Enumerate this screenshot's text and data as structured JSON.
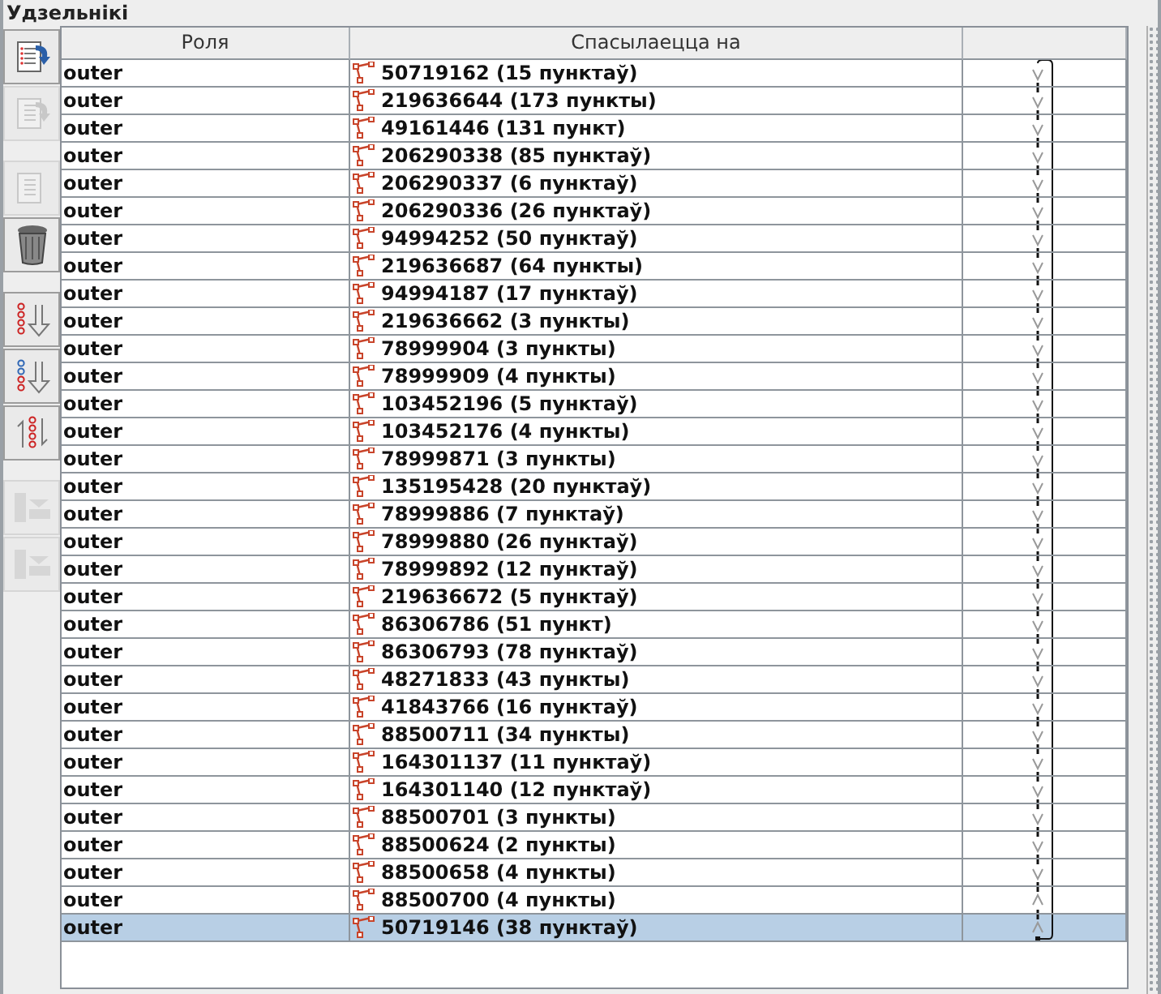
{
  "panel": {
    "title": "Удзельнікі"
  },
  "toolbar_groups": [
    [
      {
        "kind": "add-list",
        "disabled": false
      },
      {
        "kind": "doc-arrow",
        "disabled": true
      }
    ],
    [
      {
        "kind": "doc",
        "disabled": true
      },
      {
        "kind": "trash",
        "disabled": false
      }
    ],
    [
      {
        "kind": "sort",
        "disabled": false
      },
      {
        "kind": "sort-mixed",
        "disabled": false
      },
      {
        "kind": "reverse",
        "disabled": false
      }
    ],
    [
      {
        "kind": "move",
        "disabled": true
      },
      {
        "kind": "move",
        "disabled": true
      }
    ]
  ],
  "table": {
    "columns": [
      "Роля",
      "Спасылаецца на"
    ],
    "rows": [
      {
        "role": "outer",
        "ref": "50719162 (15 пунктаў)",
        "kind": "down",
        "selected": false
      },
      {
        "role": "outer",
        "ref": "219636644 (173 пункты)",
        "kind": "down",
        "selected": false
      },
      {
        "role": "outer",
        "ref": "49161446 (131 пункт)",
        "kind": "down",
        "selected": false
      },
      {
        "role": "outer",
        "ref": "206290338 (85 пунктаў)",
        "kind": "down",
        "selected": false
      },
      {
        "role": "outer",
        "ref": "206290337 (6 пунктаў)",
        "kind": "down",
        "selected": false
      },
      {
        "role": "outer",
        "ref": "206290336 (26 пунктаў)",
        "kind": "down",
        "selected": false
      },
      {
        "role": "outer",
        "ref": "94994252 (50 пунктаў)",
        "kind": "down",
        "selected": false
      },
      {
        "role": "outer",
        "ref": "219636687 (64 пункты)",
        "kind": "down",
        "selected": false
      },
      {
        "role": "outer",
        "ref": "94994187 (17 пунктаў)",
        "kind": "down",
        "selected": false
      },
      {
        "role": "outer",
        "ref": "219636662 (3 пункты)",
        "kind": "down",
        "selected": false
      },
      {
        "role": "outer",
        "ref": "78999904 (3 пункты)",
        "kind": "down",
        "selected": false
      },
      {
        "role": "outer",
        "ref": "78999909 (4 пункты)",
        "kind": "down",
        "selected": false
      },
      {
        "role": "outer",
        "ref": "103452196 (5 пунктаў)",
        "kind": "down",
        "selected": false
      },
      {
        "role": "outer",
        "ref": "103452176 (4 пункты)",
        "kind": "down",
        "selected": false
      },
      {
        "role": "outer",
        "ref": "78999871 (3 пункты)",
        "kind": "down",
        "selected": false
      },
      {
        "role": "outer",
        "ref": "135195428 (20 пунктаў)",
        "kind": "down",
        "selected": false
      },
      {
        "role": "outer",
        "ref": "78999886 (7 пунктаў)",
        "kind": "down",
        "selected": false
      },
      {
        "role": "outer",
        "ref": "78999880 (26 пунктаў)",
        "kind": "down",
        "selected": false
      },
      {
        "role": "outer",
        "ref": "78999892 (12 пунктаў)",
        "kind": "down",
        "selected": false
      },
      {
        "role": "outer",
        "ref": "219636672 (5 пунктаў)",
        "kind": "down",
        "selected": false
      },
      {
        "role": "outer",
        "ref": "86306786 (51 пункт)",
        "kind": "down",
        "selected": false
      },
      {
        "role": "outer",
        "ref": "86306793 (78 пунктаў)",
        "kind": "down",
        "selected": false
      },
      {
        "role": "outer",
        "ref": "48271833 (43 пункты)",
        "kind": "down",
        "selected": false
      },
      {
        "role": "outer",
        "ref": "41843766 (16 пунктаў)",
        "kind": "down",
        "selected": false
      },
      {
        "role": "outer",
        "ref": "88500711 (34 пункты)",
        "kind": "down",
        "selected": false
      },
      {
        "role": "outer",
        "ref": "164301137 (11 пунктаў)",
        "kind": "down",
        "selected": false
      },
      {
        "role": "outer",
        "ref": "164301140 (12 пунктаў)",
        "kind": "down",
        "selected": false
      },
      {
        "role": "outer",
        "ref": "88500701 (3 пункты)",
        "kind": "down",
        "selected": false
      },
      {
        "role": "outer",
        "ref": "88500624 (2 пункты)",
        "kind": "down",
        "selected": false
      },
      {
        "role": "outer",
        "ref": "88500658 (4 пункты)",
        "kind": "down",
        "selected": false
      },
      {
        "role": "outer",
        "ref": "88500700 (4 пункты)",
        "kind": "up",
        "selected": false
      },
      {
        "role": "outer",
        "ref": "50719146 (38 пунктаў)",
        "kind": "up",
        "selected": true
      }
    ]
  }
}
